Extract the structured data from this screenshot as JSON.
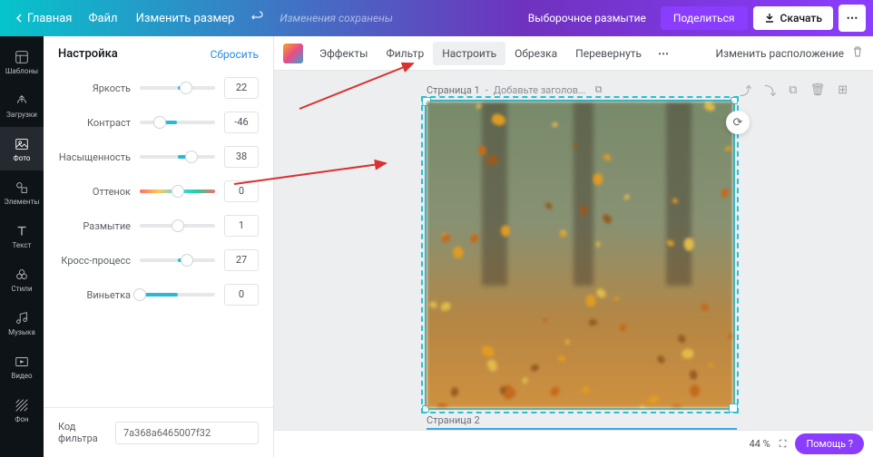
{
  "topbar": {
    "home": "Главная",
    "file": "Файл",
    "resize": "Изменить размер",
    "saved": "Изменения сохранены",
    "selective_blur": "Выборочное размытие",
    "share": "Поделиться",
    "download": "Скачать"
  },
  "leftnav": {
    "templates": "Шаблоны",
    "uploads": "Загрузки",
    "photos": "Фото",
    "elements": "Элементы",
    "text": "Текст",
    "styles": "Стили",
    "music": "Музыка",
    "video": "Видео",
    "background": "Фон"
  },
  "panel": {
    "title": "Настройка",
    "reset": "Сбросить",
    "sliders": {
      "brightness": {
        "label": "Яркость",
        "value": 22,
        "pos": 61
      },
      "contrast": {
        "label": "Контраст",
        "value": -46,
        "pos": 27
      },
      "saturation": {
        "label": "Насыщенность",
        "value": 38,
        "pos": 69
      },
      "tint": {
        "label": "Оттенок",
        "value": 0,
        "pos": 50,
        "hue": true
      },
      "blur": {
        "label": "Размытие",
        "value": 1,
        "pos": 51
      },
      "xprocess": {
        "label": "Кросс-процесс",
        "value": 27,
        "pos": 63
      },
      "vignette": {
        "label": "Виньетка",
        "value": 0,
        "pos": 0
      }
    },
    "filter_code_label": "Код фильтра",
    "filter_code": "7a368a6465007f32"
  },
  "toolbar": {
    "effects": "Эффекты",
    "filter": "Фильтр",
    "adjust": "Настроить",
    "crop": "Обрезка",
    "flip": "Перевернуть",
    "layout": "Изменить расположение"
  },
  "canvas": {
    "page1": "Страница 1",
    "add_title": "Добавьте заголов...",
    "page2": "Страница 2"
  },
  "status": {
    "zoom": "44 %",
    "help": "Помощь ?"
  }
}
